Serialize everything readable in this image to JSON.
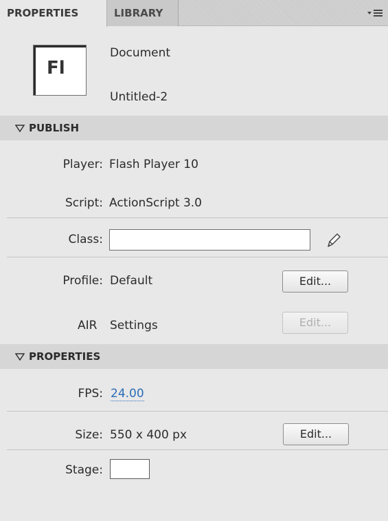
{
  "tabs": {
    "properties": "PROPERTIES",
    "library": "LIBRARY"
  },
  "panel_menu_icon": "panel-menu-icon",
  "document": {
    "icon_text": "Fl",
    "type": "Document",
    "name": "Untitled-2"
  },
  "publish": {
    "header": "PUBLISH",
    "player_label": "Player:",
    "player_value": "Flash Player 10",
    "script_label": "Script:",
    "script_value": "ActionScript 3.0",
    "class_label": "Class:",
    "class_value": "",
    "profile_label": "Profile:",
    "profile_value": "Default",
    "profile_edit": "Edit...",
    "air_label": "AIR",
    "air_value": "Settings",
    "air_edit": "Edit..."
  },
  "properties": {
    "header": "PROPERTIES",
    "fps_label": "FPS:",
    "fps_value": "24.00",
    "size_label": "Size:",
    "size_value": "550 x 400 px",
    "size_edit": "Edit...",
    "stage_label": "Stage:",
    "stage_color": "#ffffff"
  }
}
